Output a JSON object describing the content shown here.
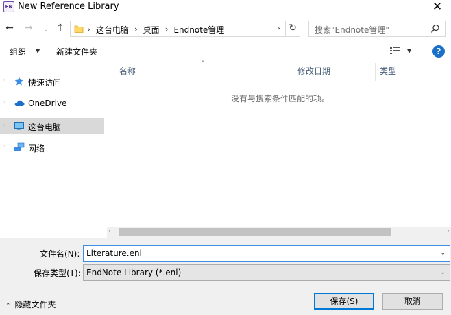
{
  "window": {
    "title": "New Reference Library",
    "app_icon_text": "EN",
    "close_glyph": "✕"
  },
  "nav": {
    "back": "←",
    "forward": "→",
    "up": "↑",
    "breadcrumbs": [
      "这台电脑",
      "桌面",
      "Endnote管理"
    ],
    "search_placeholder": "搜索\"Endnote管理\""
  },
  "commands": {
    "organize": "组织",
    "new_folder": "新建文件夹"
  },
  "sidebar": {
    "items": [
      {
        "label": "快速访问",
        "icon": "star-icon",
        "selected": false
      },
      {
        "label": "OneDrive",
        "icon": "cloud-icon",
        "selected": false
      },
      {
        "label": "这台电脑",
        "icon": "computer-icon",
        "selected": true
      },
      {
        "label": "网络",
        "icon": "network-icon",
        "selected": false
      }
    ]
  },
  "file_list": {
    "columns": [
      "名称",
      "修改日期",
      "类型"
    ],
    "empty_message": "没有与搜索条件匹配的项。"
  },
  "form": {
    "filename_label": "文件名(N):",
    "filename_value": "Literature.enl",
    "filetype_label": "保存类型(T):",
    "filetype_value": "EndNote Library (*.enl)"
  },
  "footer": {
    "hide_folders": "隐藏文件夹",
    "save": "保存(S)",
    "cancel": "取消"
  },
  "colors": {
    "accent": "#0078d7",
    "selection": "#d9d9d9",
    "help": "#1a6fc9"
  }
}
